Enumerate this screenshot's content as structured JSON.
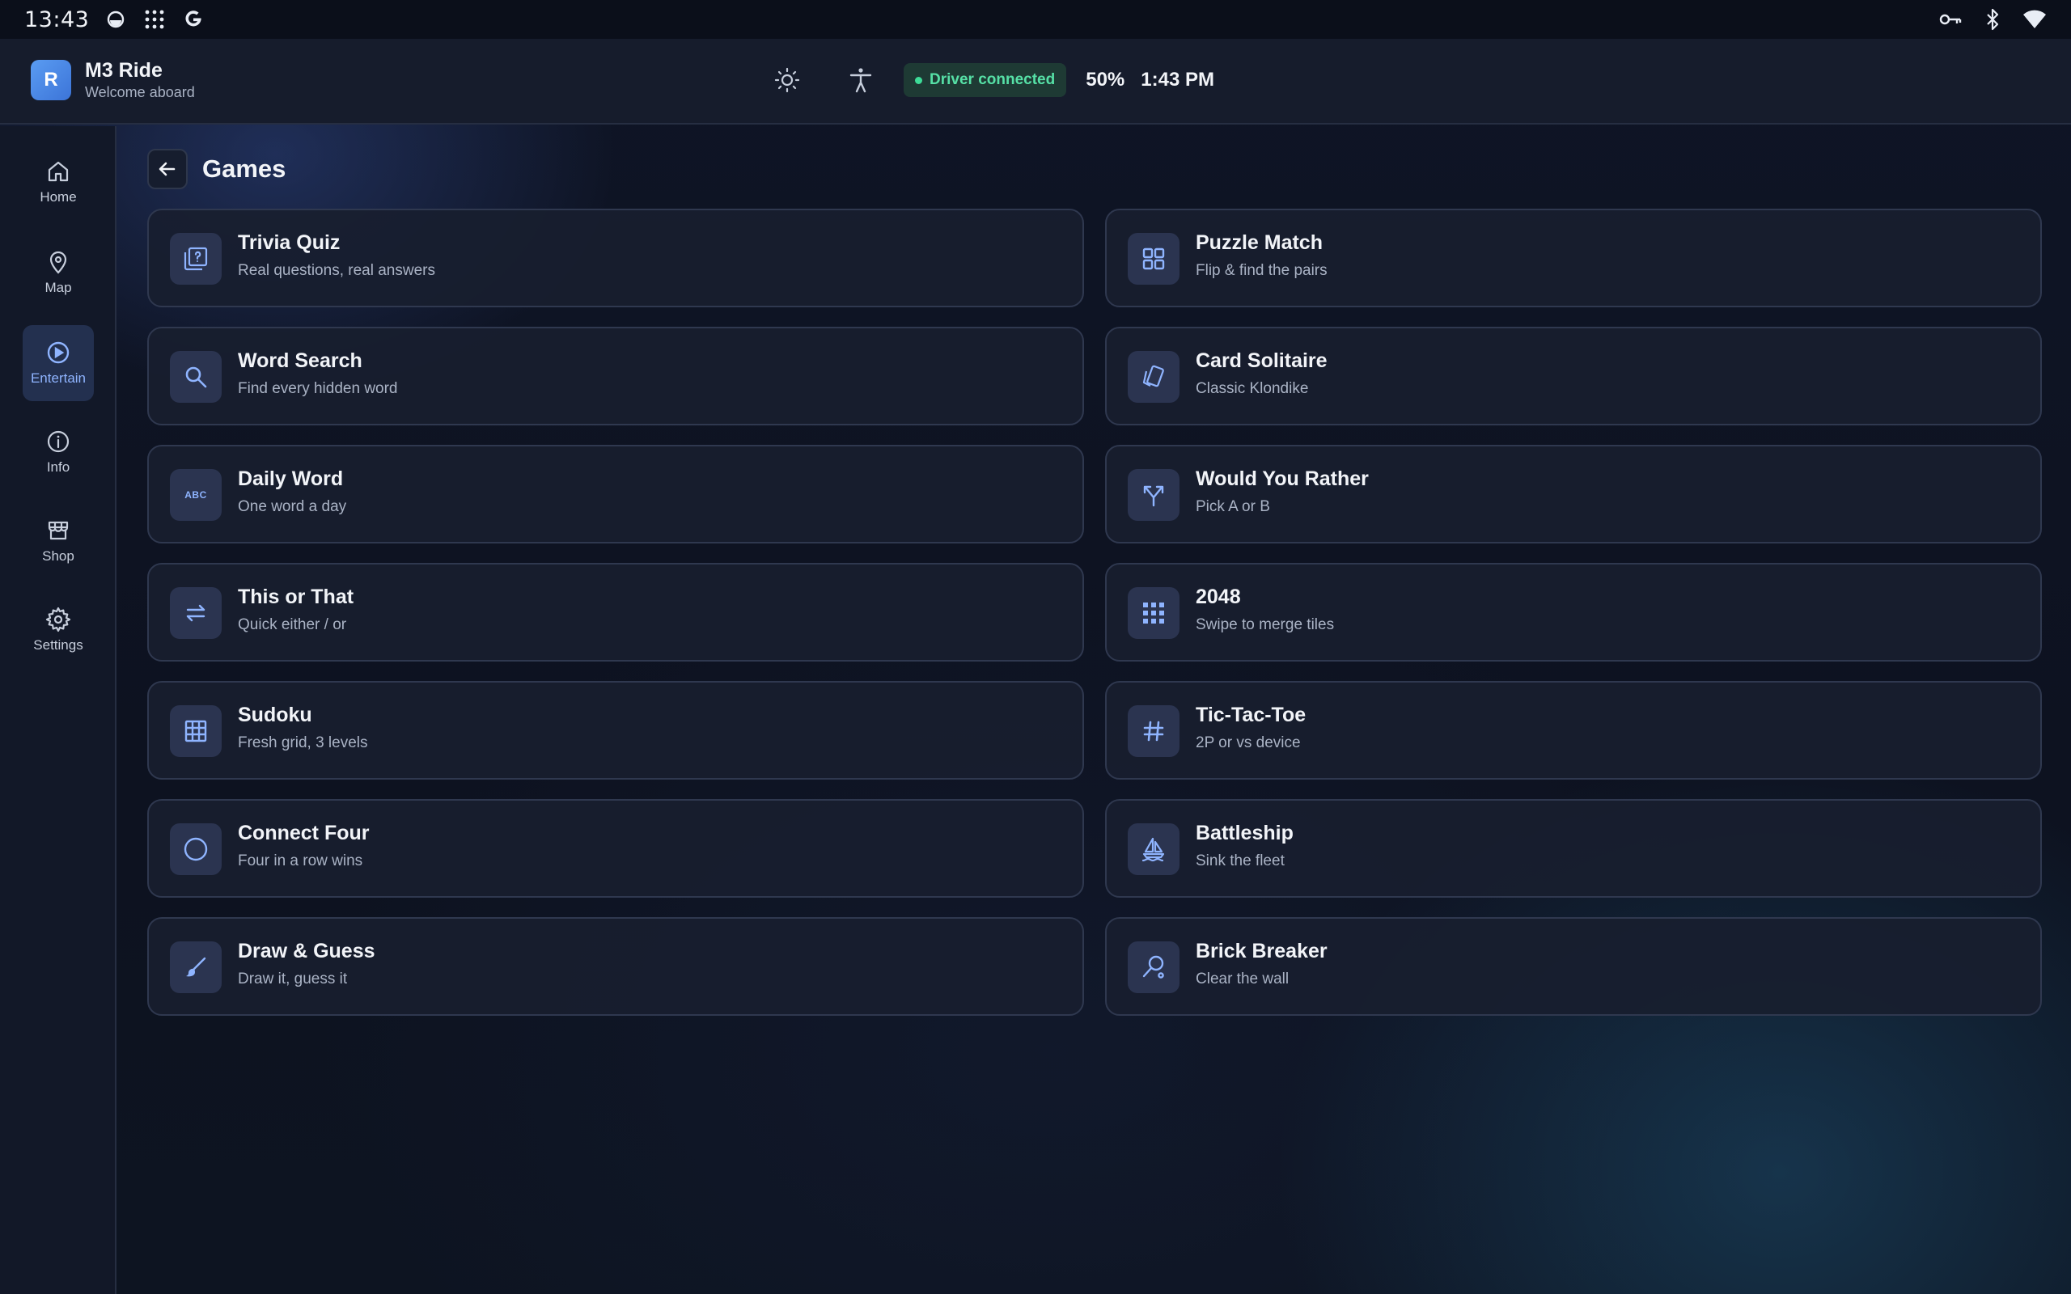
{
  "status_bar": {
    "time": "13:43",
    "left_icons": [
      "circle-indicator-icon",
      "apps-grid-icon",
      "google-g-icon"
    ],
    "right_icons": [
      "vpn-key-icon",
      "bluetooth-icon",
      "wifi-icon"
    ]
  },
  "header": {
    "logo_letter": "R",
    "app_name": "M3 Ride",
    "welcome": "Welcome aboard",
    "driver_status": "Driver connected",
    "battery": "50%",
    "clock": "1:43 PM",
    "status_color": "#3ddc97"
  },
  "sidebar": {
    "items": [
      {
        "label": "Home",
        "icon": "home-icon",
        "active": false
      },
      {
        "label": "Map",
        "icon": "map-pin-icon",
        "active": false
      },
      {
        "label": "Entertain",
        "icon": "play-circle-icon",
        "active": true
      },
      {
        "label": "Info",
        "icon": "info-icon",
        "active": false
      },
      {
        "label": "Shop",
        "icon": "store-icon",
        "active": false
      },
      {
        "label": "Settings",
        "icon": "gear-icon",
        "active": false
      }
    ]
  },
  "page": {
    "title": "Games"
  },
  "games": [
    {
      "title": "Trivia Quiz",
      "subtitle": "Real questions, real answers",
      "icon": "quiz-icon"
    },
    {
      "title": "Puzzle Match",
      "subtitle": "Flip & find the pairs",
      "icon": "grid-view-icon"
    },
    {
      "title": "Word Search",
      "subtitle": "Find every hidden word",
      "icon": "search-icon"
    },
    {
      "title": "Card Solitaire",
      "subtitle": "Classic Klondike",
      "icon": "cards-icon"
    },
    {
      "title": "Daily Word",
      "subtitle": "One word a day",
      "icon": "abc-icon",
      "icon_text": "ABC"
    },
    {
      "title": "Would You Rather",
      "subtitle": "Pick A or B",
      "icon": "fork-arrows-icon"
    },
    {
      "title": "This or That",
      "subtitle": "Quick either / or",
      "icon": "swap-arrows-icon"
    },
    {
      "title": "2048",
      "subtitle": "Swipe to merge tiles",
      "icon": "apps-icon"
    },
    {
      "title": "Sudoku",
      "subtitle": "Fresh grid, 3 levels",
      "icon": "grid-3x3-icon"
    },
    {
      "title": "Tic-Tac-Toe",
      "subtitle": "2P or vs device",
      "icon": "hashtag-icon"
    },
    {
      "title": "Connect Four",
      "subtitle": "Four in a row wins",
      "icon": "circle-icon"
    },
    {
      "title": "Battleship",
      "subtitle": "Sink the fleet",
      "icon": "sailboat-icon"
    },
    {
      "title": "Draw & Guess",
      "subtitle": "Draw it, guess it",
      "icon": "brush-icon"
    },
    {
      "title": "Brick Breaker",
      "subtitle": "Clear the wall",
      "icon": "paddle-icon"
    }
  ],
  "colors": {
    "accent": "#8fb4ff",
    "card_icon": "#8fb4ff"
  }
}
